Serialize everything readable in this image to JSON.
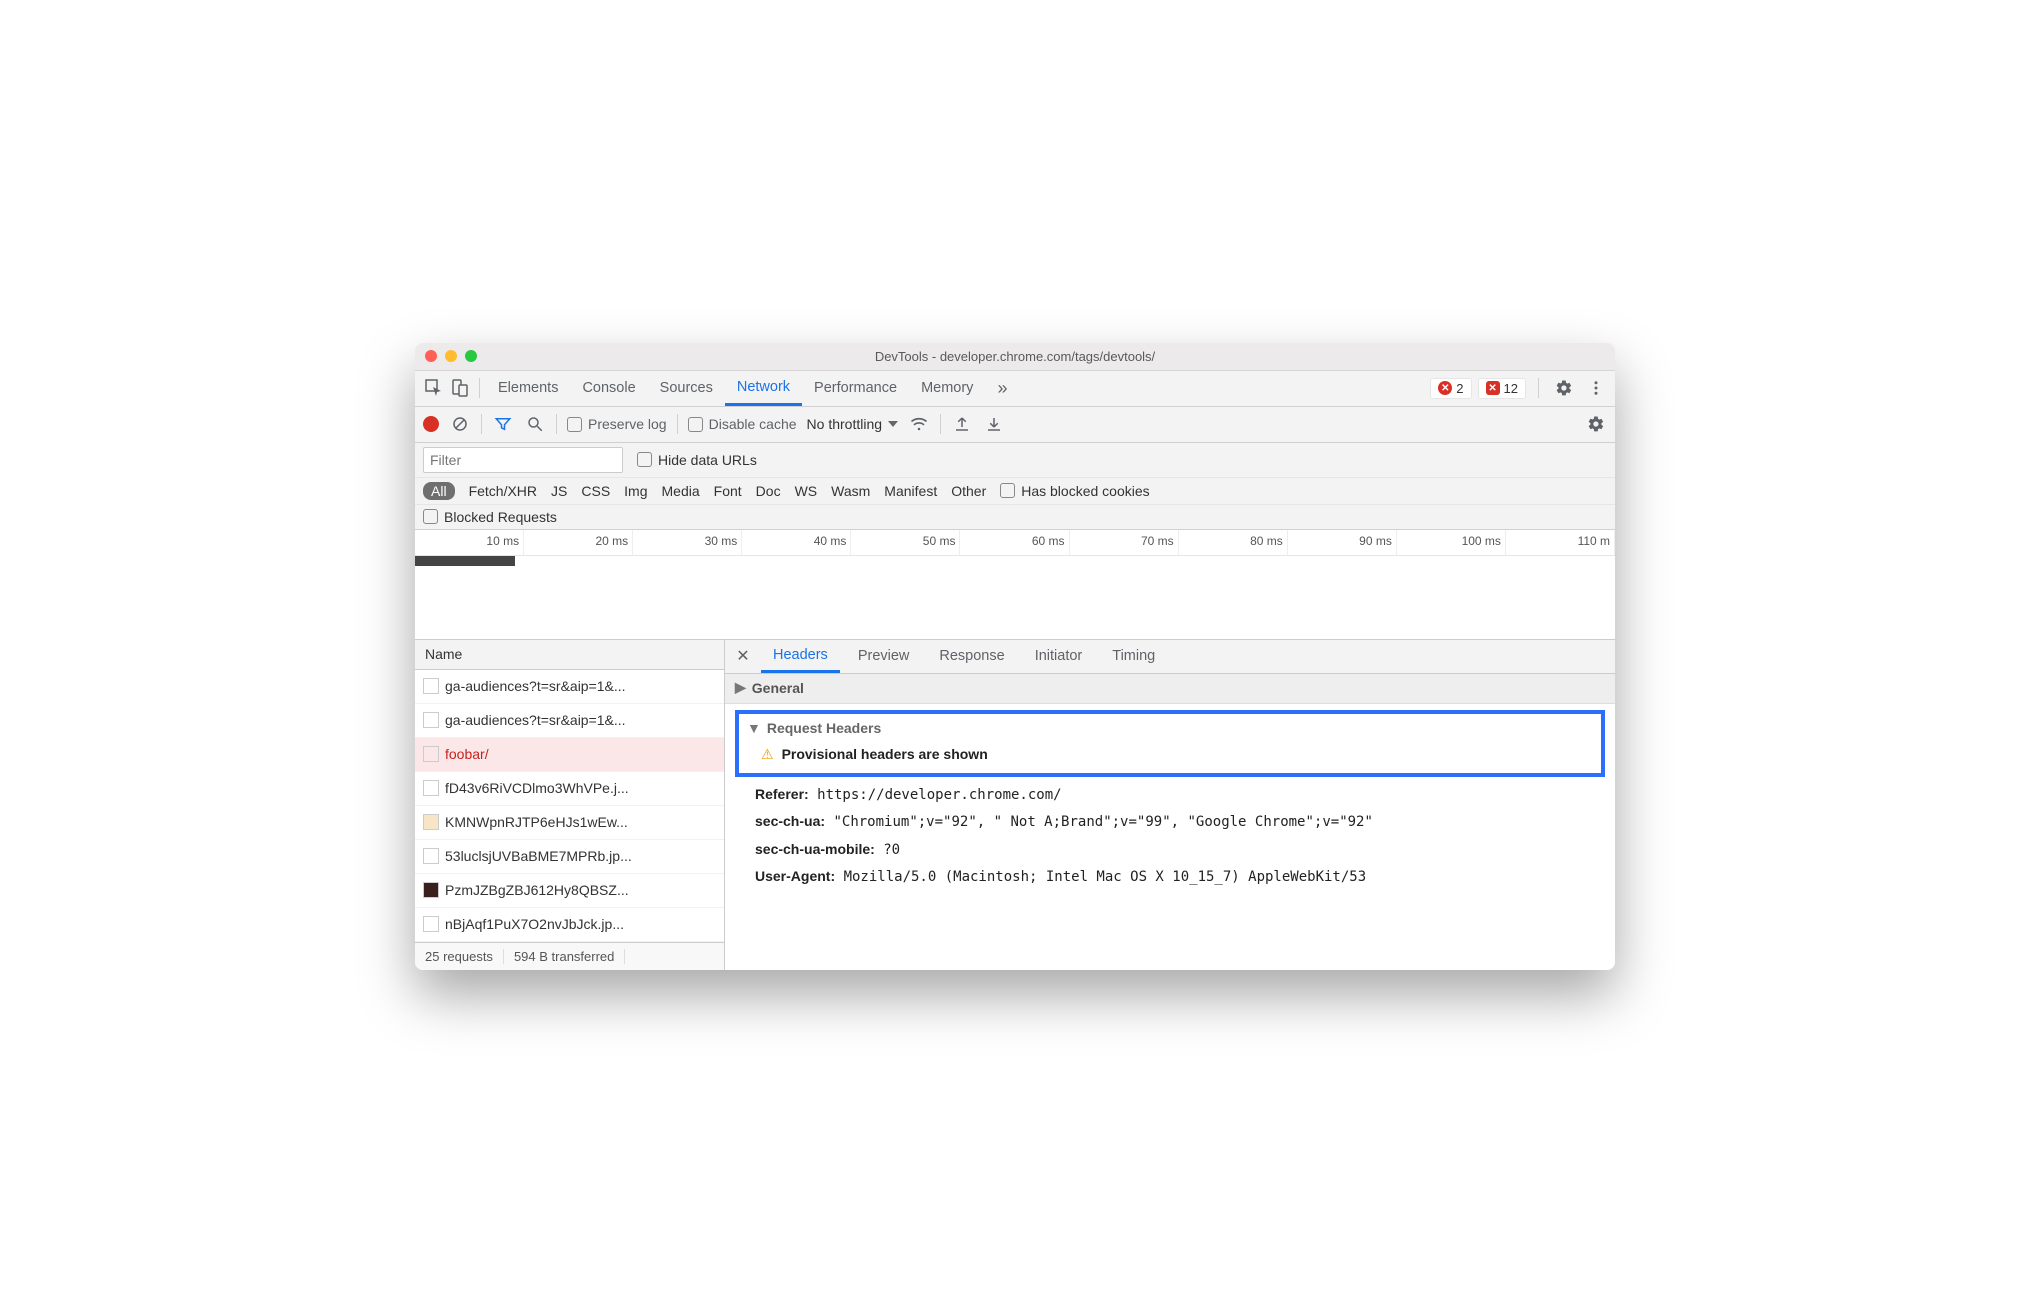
{
  "window": {
    "title": "DevTools - developer.chrome.com/tags/devtools/"
  },
  "tabstrip": {
    "tabs": [
      "Elements",
      "Console",
      "Sources",
      "Network",
      "Performance",
      "Memory"
    ],
    "active_index": 3,
    "overflow_glyph": "»",
    "error_count": "2",
    "issue_count": "12"
  },
  "net_toolbar": {
    "preserve_log": "Preserve log",
    "disable_cache": "Disable cache",
    "throttling": "No throttling"
  },
  "filter": {
    "placeholder": "Filter",
    "hide_data_urls": "Hide data URLs",
    "chips": [
      "All",
      "Fetch/XHR",
      "JS",
      "CSS",
      "Img",
      "Media",
      "Font",
      "Doc",
      "WS",
      "Wasm",
      "Manifest",
      "Other"
    ],
    "has_blocked_cookies": "Has blocked cookies",
    "blocked_requests": "Blocked Requests"
  },
  "timeline": {
    "ticks": [
      "10 ms",
      "20 ms",
      "30 ms",
      "40 ms",
      "50 ms",
      "60 ms",
      "70 ms",
      "80 ms",
      "90 ms",
      "100 ms",
      "110 m"
    ]
  },
  "request_list": {
    "header": "Name",
    "rows": [
      {
        "name": "ga-audiences?t=sr&aip=1&...",
        "icon": "blank"
      },
      {
        "name": "ga-audiences?t=sr&aip=1&...",
        "icon": "blank"
      },
      {
        "name": "foobar/",
        "icon": "blank",
        "selected": true
      },
      {
        "name": "fD43v6RiVCDlmo3WhVPe.j...",
        "icon": "blank"
      },
      {
        "name": "KMNWpnRJTP6eHJs1wEw...",
        "icon": "img1"
      },
      {
        "name": "53luclsjUVBaBME7MPRb.jp...",
        "icon": "blank"
      },
      {
        "name": "PzmJZBgZBJ612Hy8QBSZ...",
        "icon": "img2"
      },
      {
        "name": "nBjAqf1PuX7O2nvJbJck.jp...",
        "icon": "blank"
      }
    ],
    "footer": {
      "requests": "25 requests",
      "transferred": "594 B transferred"
    }
  },
  "detail": {
    "tabs": [
      "Headers",
      "Preview",
      "Response",
      "Initiator",
      "Timing"
    ],
    "active_index": 0,
    "general_label": "General",
    "request_headers_label": "Request Headers",
    "provisional_label": "Provisional headers are shown",
    "headers": {
      "Referer": "https://developer.chrome.com/",
      "sec-ch-ua": "\"Chromium\";v=\"92\", \" Not A;Brand\";v=\"99\", \"Google Chrome\";v=\"92\"",
      "sec-ch-ua-mobile": "?0",
      "User-Agent": "Mozilla/5.0 (Macintosh; Intel Mac OS X 10_15_7) AppleWebKit/53"
    }
  }
}
